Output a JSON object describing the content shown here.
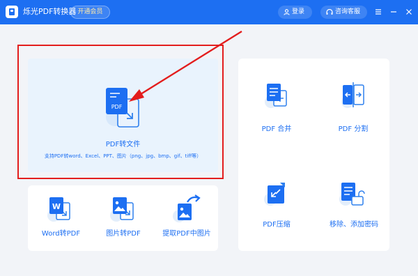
{
  "titlebar": {
    "app_title": "烁光PDF转换器",
    "vip_button": "开通会员",
    "login_button": "登录",
    "support_button": "咨询客服",
    "accent_color": "#1d6ff2"
  },
  "main_feature": {
    "label": "PDF转文件",
    "icon_text": "PDF",
    "subtitle": "支持PDF转word、Excel、PPT、图片（png、jpg、bmp、gif、tiff等）"
  },
  "bottom_features": [
    {
      "label": "Word转PDF",
      "icon": "word-to-pdf-icon",
      "icon_text": "W"
    },
    {
      "label": "图片转PDF",
      "icon": "image-to-pdf-icon"
    },
    {
      "label": "提取PDF中图片",
      "icon": "extract-image-icon"
    }
  ],
  "right_features": [
    {
      "label": "PDF 合并",
      "icon": "merge-icon"
    },
    {
      "label": "PDF 分割",
      "icon": "split-icon"
    },
    {
      "label": "PDF压缩",
      "icon": "compress-icon"
    },
    {
      "label": "移除、添加密码",
      "icon": "lock-icon"
    }
  ],
  "annotation": {
    "color": "#e31d1d"
  }
}
